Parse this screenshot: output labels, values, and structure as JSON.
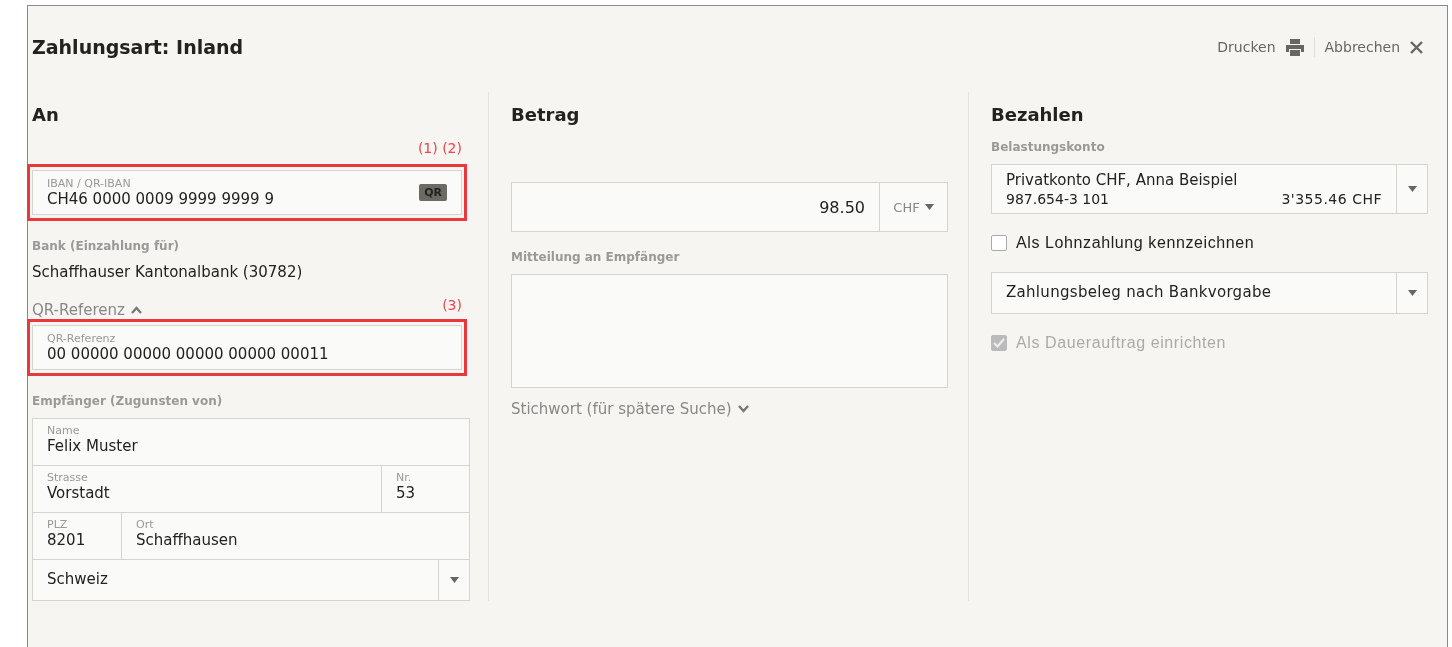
{
  "dialog": {
    "title": "Zahlungsart: Inland",
    "actions": [
      {
        "label": "Drucken"
      },
      {
        "label": "Abbrechen"
      }
    ]
  },
  "to": {
    "heading": "An",
    "iban": {
      "annotation": "(1) (2)",
      "label": "IBAN / QR-IBAN",
      "value": "CH46 0000 0009 9999 9999 9",
      "badge": "QR"
    },
    "bank": {
      "label": "Bank (Einzahlung für)",
      "value": "Schaffhauser Kantonalbank (30782)"
    },
    "reference_toggle": {
      "label": "QR-Referenz",
      "expanded": true
    },
    "reference": {
      "annotation": "(3)",
      "label": "QR-Referenz",
      "value": "00 00000 00000 00000 00000 00011"
    },
    "recipient": {
      "label": "Empfänger (Zugunsten von)",
      "rows": [
        [
          {
            "label": "Name",
            "value": "Felix Muster"
          }
        ],
        [
          {
            "label": "Strasse",
            "value": "Vorstadt"
          },
          {
            "label": "Nr.",
            "value": "53"
          }
        ],
        [
          {
            "label": "PLZ",
            "value": "8201"
          },
          {
            "label": "Ort",
            "value": "Schaffhausen"
          }
        ]
      ],
      "country": "Schweiz"
    }
  },
  "amount": {
    "heading": "Betrag",
    "value": "98.50",
    "currency": "CHF",
    "message_label": "Mitteilung an Empfänger",
    "keyword_toggle": {
      "label": "Stichwort (für spätere Suche)",
      "expanded": false
    }
  },
  "pay": {
    "heading": "Bezahlen",
    "account_label": "Belastungskonto",
    "account": {
      "name": "Privatkonto CHF, Anna Beispiel",
      "number": "987.654-3 101",
      "balance": "3'355.46 CHF"
    },
    "options": [
      {
        "kind": "checkbox",
        "label": "Als Lohnzahlung kennzeichnen",
        "checked": false,
        "disabled": false
      },
      {
        "kind": "select",
        "value": "Zahlungsbeleg nach Bankvorgabe"
      },
      {
        "kind": "checkbox",
        "label": "Als Dauerauftrag einrichten",
        "checked": true,
        "disabled": true
      }
    ]
  }
}
